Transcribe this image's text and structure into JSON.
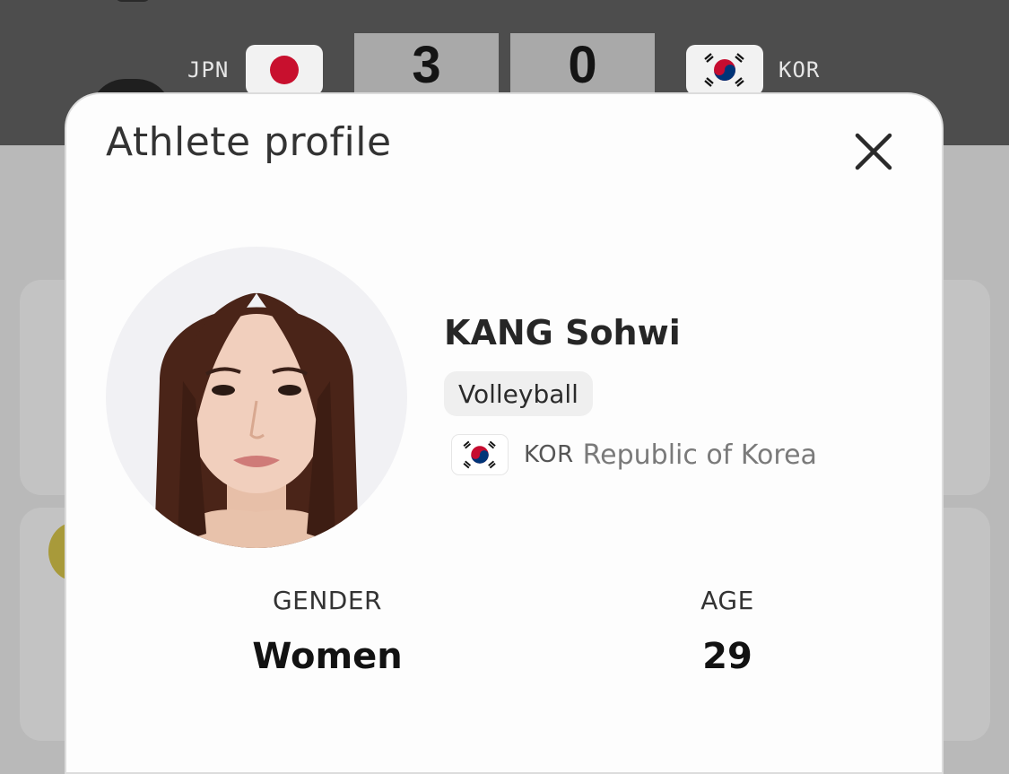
{
  "scoreboard": {
    "home": {
      "code": "JPN",
      "score": "3",
      "flag_icon": "japan-flag-icon"
    },
    "away": {
      "code": "KOR",
      "score": "0",
      "flag_icon": "korea-flag-icon"
    }
  },
  "modal": {
    "title": "Athlete profile",
    "close_icon": "close-icon"
  },
  "athlete": {
    "name": "KANG Sohwi",
    "sport": "Volleyball",
    "country_code": "KOR",
    "country_name": "Republic of Korea",
    "flag_icon": "korea-flag-icon"
  },
  "stats": {
    "gender_label": "GENDER",
    "gender_value": "Women",
    "age_label": "AGE",
    "age_value": "29"
  },
  "colors": {
    "header_bg": "#4d4d4d",
    "score_box": "#a9a9a9",
    "modal_bg": "#fdfdfd",
    "pill_bg": "#efefef"
  }
}
